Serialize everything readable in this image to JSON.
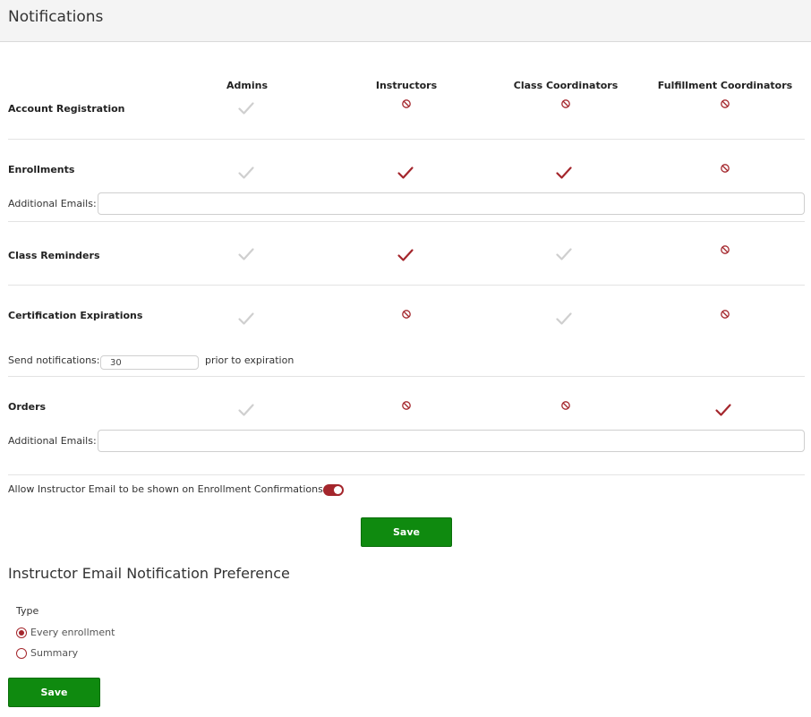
{
  "header": {
    "title": "Notifications"
  },
  "columns": [
    "Admins",
    "Instructors",
    "Class Coordinators",
    "Fulfillment Coordinators"
  ],
  "rows": [
    {
      "label": "Account Registration",
      "values": [
        "check-disabled",
        "blocked",
        "blocked",
        "blocked"
      ]
    },
    {
      "label": "Enrollments",
      "values": [
        "check-disabled",
        "check-on",
        "check-on",
        "blocked"
      ]
    },
    {
      "label": "Class Reminders",
      "values": [
        "check-disabled",
        "check-on",
        "check-disabled",
        "blocked"
      ]
    },
    {
      "label": "Certification Expirations",
      "values": [
        "check-disabled",
        "blocked",
        "check-disabled",
        "blocked"
      ]
    },
    {
      "label": "Orders",
      "values": [
        "check-disabled",
        "blocked",
        "blocked",
        "check-on"
      ]
    }
  ],
  "enrollments_extra": {
    "label": "Additional Emails:",
    "value": ""
  },
  "cert_extra": {
    "prefix": "Send notifications:",
    "value": "30",
    "suffix": "prior to expiration"
  },
  "orders_extra": {
    "label": "Additional Emails:",
    "value": ""
  },
  "allow_instructor_email": {
    "label": "Allow Instructor Email to be shown on Enrollment Confirmations:",
    "enabled": true
  },
  "save_label": "Save",
  "preference": {
    "title": "Instructor Email Notification Preference",
    "type_label": "Type",
    "options": [
      {
        "label": "Every enrollment",
        "selected": true
      },
      {
        "label": "Summary",
        "selected": false
      }
    ],
    "save_label": "Save"
  },
  "colors": {
    "accent": "#a4262c",
    "disabled": "#cfcfcf",
    "save_button": "#0f8a0f"
  }
}
